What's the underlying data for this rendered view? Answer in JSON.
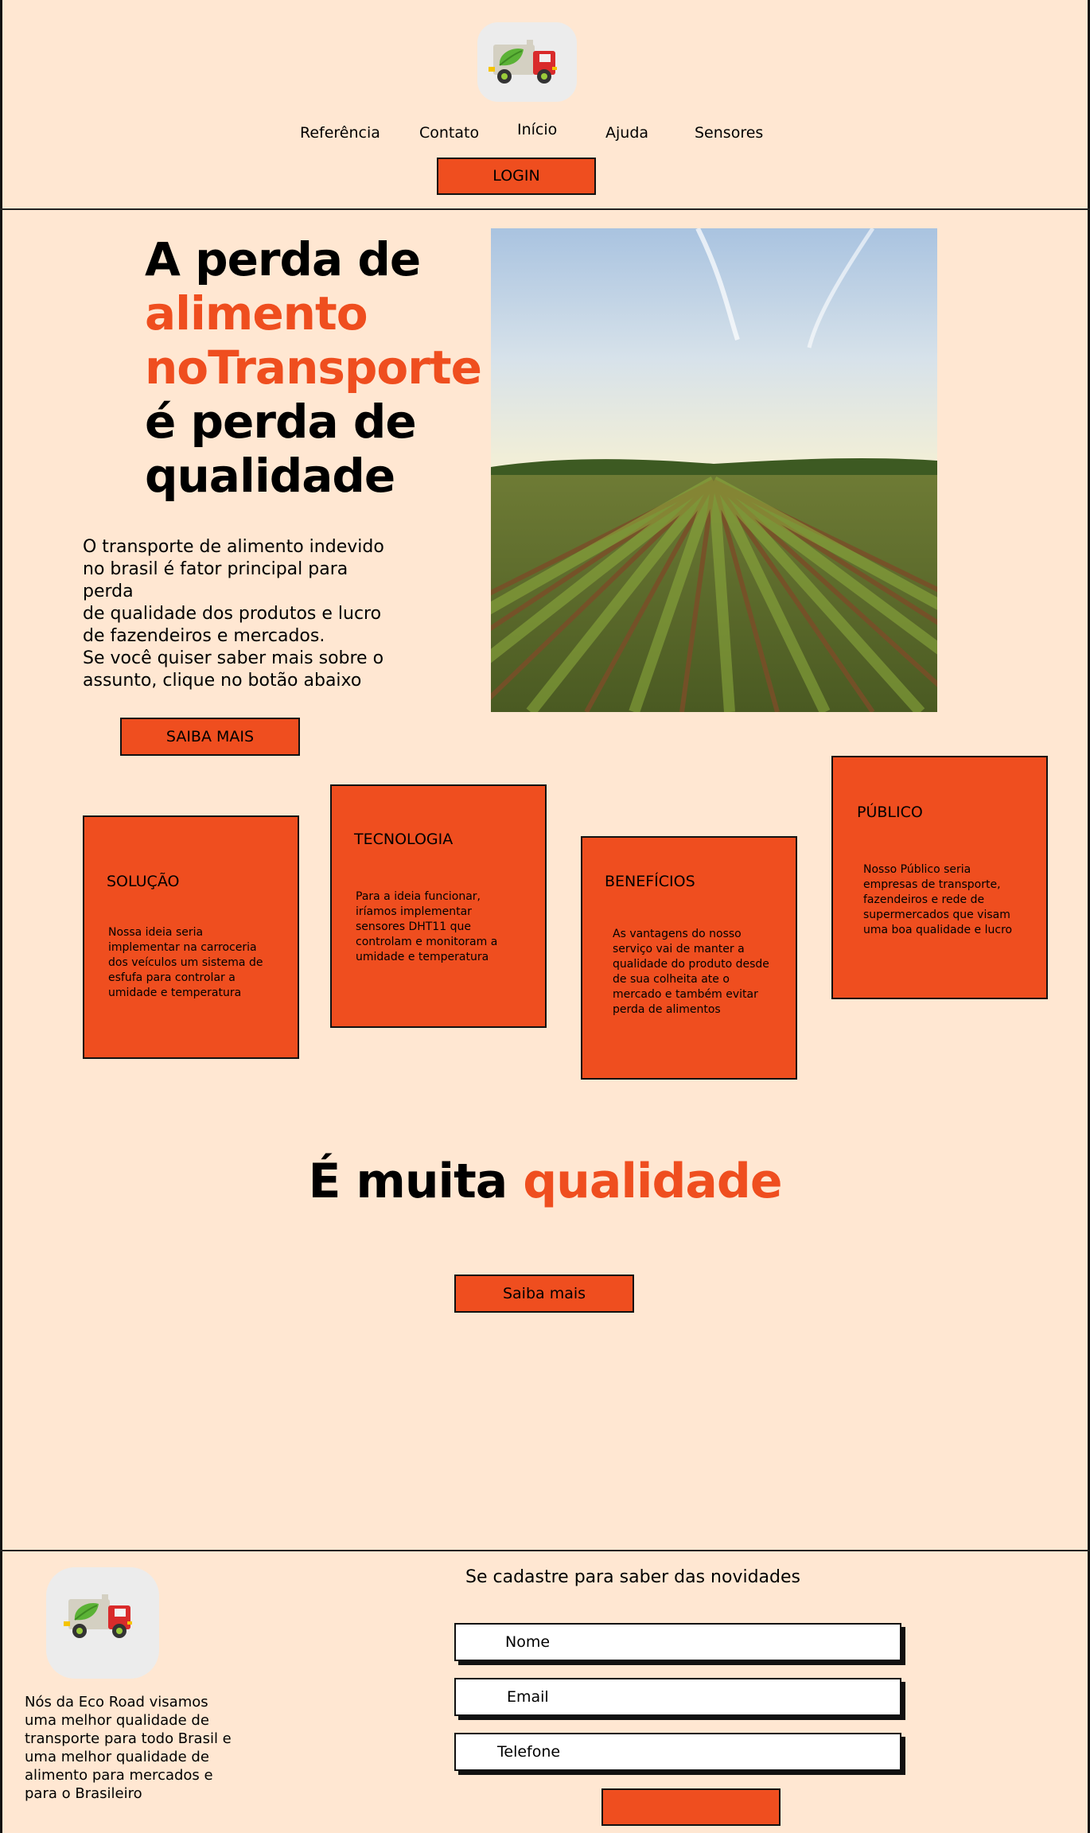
{
  "colors": {
    "background": "#ffe7d2",
    "accent": "#ef4e1f",
    "border": "#111111"
  },
  "header": {
    "logo_icon": "eco-truck-icon",
    "nav": [
      {
        "label": "Referência"
      },
      {
        "label": "Contato"
      },
      {
        "label": "Início"
      },
      {
        "label": "Ajuda"
      },
      {
        "label": "Sensores"
      }
    ],
    "login_label": "LOGIN"
  },
  "hero": {
    "title_line1": "A perda de",
    "title_line2": "alimento",
    "title_line3": "noTransporte",
    "title_line4": "é perda de",
    "title_line5": "qualidade",
    "description_lines": [
      "O transporte de alimento indevido",
      "no brasil é fator principal para perda",
      "de qualidade dos produtos e lucro",
      "de fazendeiros e mercados.",
      "Se você quiser saber mais sobre o",
      "assunto, clique no botão abaixo"
    ],
    "image_icon": "crop-field-photo",
    "button_label": "SAIBA MAIS"
  },
  "cards": [
    {
      "title": "SOLUÇÃO",
      "lines": [
        "Nossa ideia seria",
        "implementar na carroceria",
        "dos veículos um sistema de",
        "esfufa para controlar a",
        "umidade e temperatura"
      ]
    },
    {
      "title": "TECNOLOGIA",
      "lines": [
        "Para a ideia funcionar,",
        "iríamos implementar",
        "sensores DHT11 que",
        "controlam e monitoram a",
        "umidade e temperatura"
      ]
    },
    {
      "title": "BENEFÍCIOS",
      "lines": [
        "As vantagens do nosso",
        "serviço vai de manter a",
        "qualidade do produto desde",
        "de sua colheita ate o",
        "mercado e também evitar",
        "perda de alimentos"
      ]
    },
    {
      "title": "PÚBLICO",
      "lines": [
        "Nosso Público seria",
        "empresas de transporte,",
        "fazendeiros e rede de",
        "supermercados que visam",
        "uma boa qualidade e lucro"
      ]
    }
  ],
  "quality": {
    "title_plain": "É muita",
    "title_accent": "qualidade",
    "button_label": "Saiba mais"
  },
  "footer": {
    "logo_icon": "eco-truck-icon",
    "description_lines": [
      "Nós da Eco Road visamos",
      "uma melhor qualidade de",
      "transporte para todo Brasil e",
      "uma melhor qualidade de",
      "alimento para mercados e",
      "para o Brasileiro"
    ],
    "signup_title": "Se cadastre para saber das novidades",
    "fields": [
      {
        "label": "Nome"
      },
      {
        "label": "Email"
      },
      {
        "label": "Telefone"
      }
    ],
    "submit_label": ""
  }
}
